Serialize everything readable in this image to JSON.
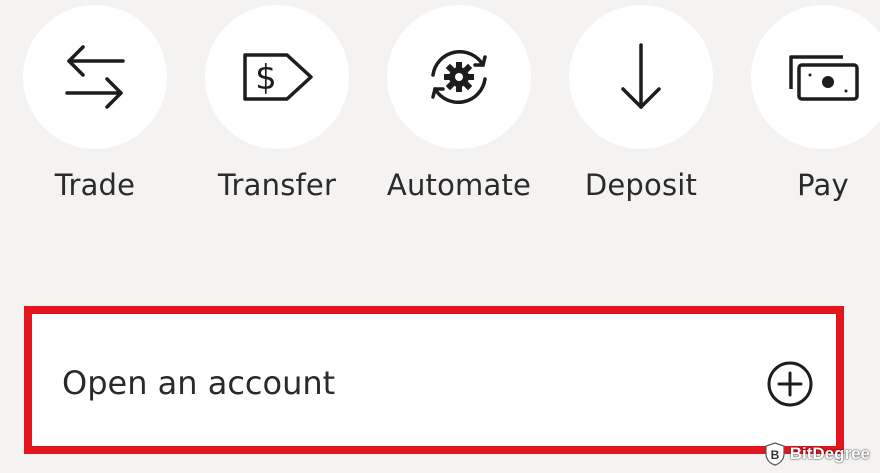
{
  "quick_actions": [
    {
      "label": "Trade",
      "icon": "trade-arrows-icon"
    },
    {
      "label": "Transfer",
      "icon": "dollar-tag-icon"
    },
    {
      "label": "Automate",
      "icon": "gear-cycle-icon"
    },
    {
      "label": "Deposit",
      "icon": "arrow-down-icon"
    },
    {
      "label": "Pay",
      "icon": "bills-icon"
    }
  ],
  "open_account": {
    "label": "Open an account",
    "icon": "plus-circle-icon"
  },
  "highlight_color": "#e4151d",
  "watermark": {
    "text": "BitDegree"
  }
}
